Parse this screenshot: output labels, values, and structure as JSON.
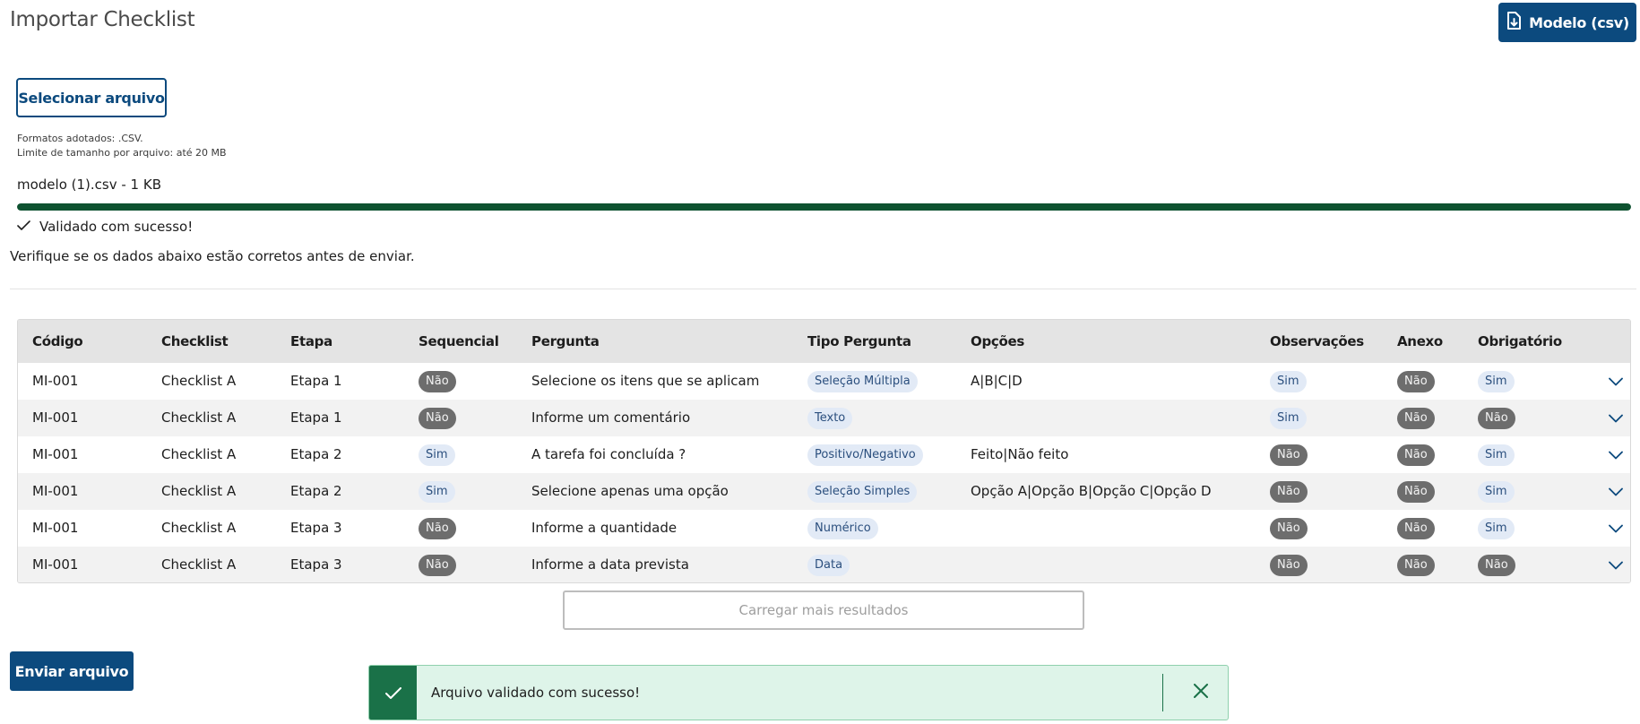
{
  "page": {
    "title": "Importar Checklist",
    "model_button_label": "Modelo (csv)",
    "select_button_label": "Selecionar arquivo",
    "formats_hint": "Formatos adotados: .CSV.",
    "size_hint": "Limite de tamanho por arquivo: até 20 MB",
    "file_name": "modelo (1).csv - 1 KB",
    "upload_progress_percent": 100,
    "validated_text": "Validado com sucesso!",
    "verify_text": "Verifique se os dados abaixo estão corretos antes de enviar.",
    "load_more_label": "Carregar mais resultados",
    "send_button_label": "Enviar arquivo"
  },
  "table": {
    "headers": {
      "codigo": "Código",
      "checklist": "Checklist",
      "etapa": "Etapa",
      "sequencial": "Sequencial",
      "pergunta": "Pergunta",
      "tipo": "Tipo Pergunta",
      "opcoes": "Opções",
      "observacoes": "Observações",
      "anexo": "Anexo",
      "obrigatorio": "Obrigatório"
    },
    "rows": [
      {
        "codigo": "MI-001",
        "checklist": "Checklist A",
        "etapa": "Etapa 1",
        "sequencial": "Não",
        "pergunta": "Selecione os itens que se aplicam",
        "tipo": "Seleção Múltipla",
        "opcoes": "A|B|C|D",
        "observacoes": "Sim",
        "anexo": "Não",
        "obrigatorio": "Sim"
      },
      {
        "codigo": "MI-001",
        "checklist": "Checklist A",
        "etapa": "Etapa 1",
        "sequencial": "Não",
        "pergunta": "Informe um comentário",
        "tipo": "Texto",
        "opcoes": "",
        "observacoes": "Sim",
        "anexo": "Não",
        "obrigatorio": "Não"
      },
      {
        "codigo": "MI-001",
        "checklist": "Checklist A",
        "etapa": "Etapa 2",
        "sequencial": "Sim",
        "pergunta": "A tarefa foi concluída ?",
        "tipo": "Positivo/Negativo",
        "opcoes": "Feito|Não feito",
        "observacoes": "Não",
        "anexo": "Não",
        "obrigatorio": "Sim"
      },
      {
        "codigo": "MI-001",
        "checklist": "Checklist A",
        "etapa": "Etapa 2",
        "sequencial": "Sim",
        "pergunta": "Selecione apenas uma opção",
        "tipo": "Seleção Simples",
        "opcoes": "Opção A|Opção B|Opção C|Opção D",
        "observacoes": "Não",
        "anexo": "Não",
        "obrigatorio": "Sim"
      },
      {
        "codigo": "MI-001",
        "checklist": "Checklist A",
        "etapa": "Etapa 3",
        "sequencial": "Não",
        "pergunta": "Informe a quantidade",
        "tipo": "Numérico",
        "opcoes": "",
        "observacoes": "Não",
        "anexo": "Não",
        "obrigatorio": "Sim"
      },
      {
        "codigo": "MI-001",
        "checklist": "Checklist A",
        "etapa": "Etapa 3",
        "sequencial": "Não",
        "pergunta": "Informe a data prevista",
        "tipo": "Data",
        "opcoes": "",
        "observacoes": "Não",
        "anexo": "Não",
        "obrigatorio": "Não"
      }
    ]
  },
  "toast": {
    "message": "Arquivo validado com sucesso!"
  },
  "icons": {
    "model": "file-download-icon",
    "validated": "check-icon",
    "row_expand": "chevron-down-icon",
    "toast_status": "check-icon",
    "toast_close": "close-icon"
  },
  "colors": {
    "primary": "#0c4a7e",
    "progress": "#0e5230",
    "toast_bg": "#def4e9",
    "toast_accent": "#1a7148",
    "pill_no": "#6d6d6d",
    "pill_yes": "#e2eaf6"
  }
}
